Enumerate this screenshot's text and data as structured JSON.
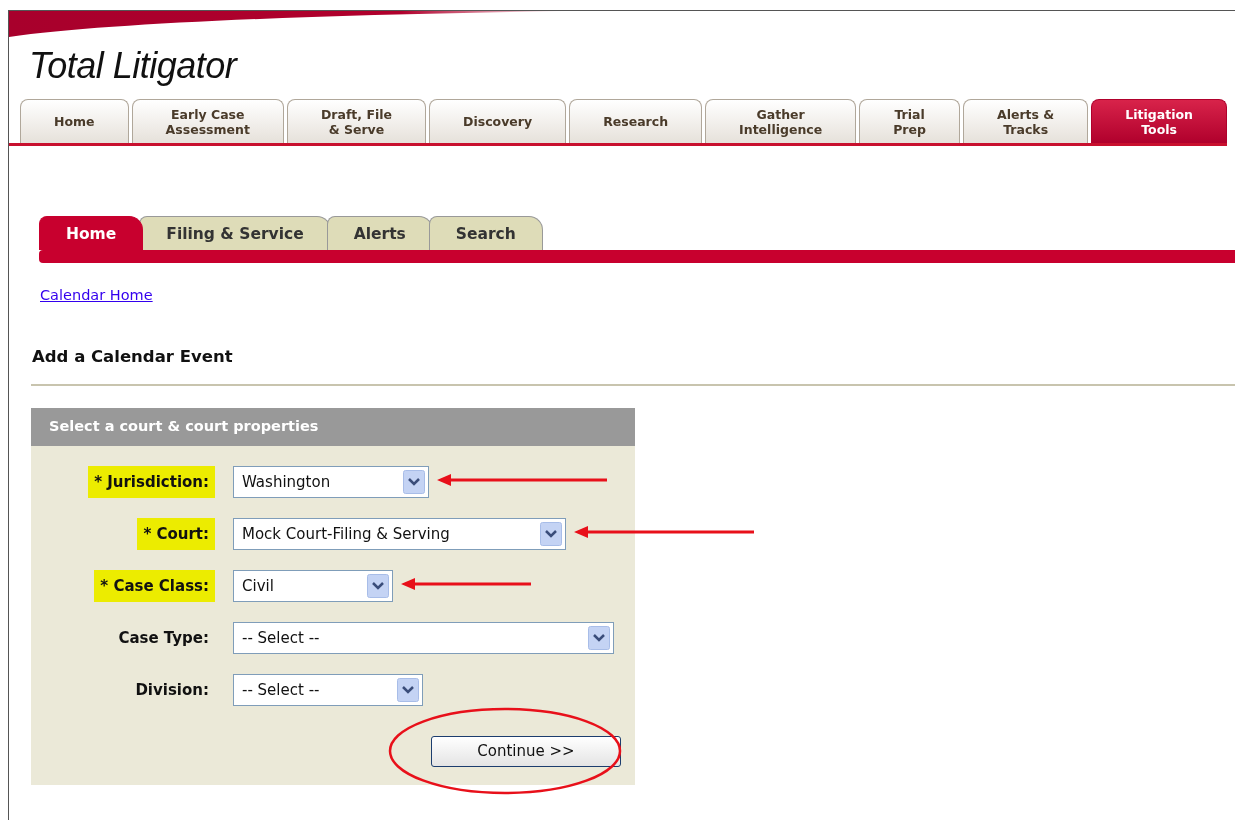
{
  "app_title": "Total Litigator",
  "main_tabs": [
    {
      "label": "Home",
      "selected": false
    },
    {
      "label": "Early Case\nAssessment",
      "selected": false
    },
    {
      "label": "Draft, File\n& Serve",
      "selected": false
    },
    {
      "label": "Discovery",
      "selected": false
    },
    {
      "label": "Research",
      "selected": false
    },
    {
      "label": "Gather\nIntelligence",
      "selected": false
    },
    {
      "label": "Trial\nPrep",
      "selected": false
    },
    {
      "label": "Alerts &\nTracks",
      "selected": false
    },
    {
      "label": "Litigation\nTools",
      "selected": true
    }
  ],
  "sub_tabs": [
    {
      "label": "Home",
      "selected": true
    },
    {
      "label": "Filing & Service",
      "selected": false
    },
    {
      "label": "Alerts",
      "selected": false
    },
    {
      "label": "Search",
      "selected": false
    }
  ],
  "breadcrumb_link": "Calendar Home",
  "page_heading": "Add a Calendar Event",
  "form": {
    "title": "Select a court & court properties",
    "fields": [
      {
        "label": "* Jurisdiction:",
        "value": "Washington",
        "highlighted": true
      },
      {
        "label": "* Court:",
        "value": "Mock Court-Filing & Serving",
        "highlighted": true
      },
      {
        "label": "* Case Class:",
        "value": "Civil",
        "highlighted": true
      },
      {
        "label": "Case Type:",
        "value": "-- Select --",
        "highlighted": false
      },
      {
        "label": "Division:",
        "value": "-- Select --",
        "highlighted": false
      }
    ],
    "button": {
      "label": "Continue >>",
      "circled": true
    }
  }
}
